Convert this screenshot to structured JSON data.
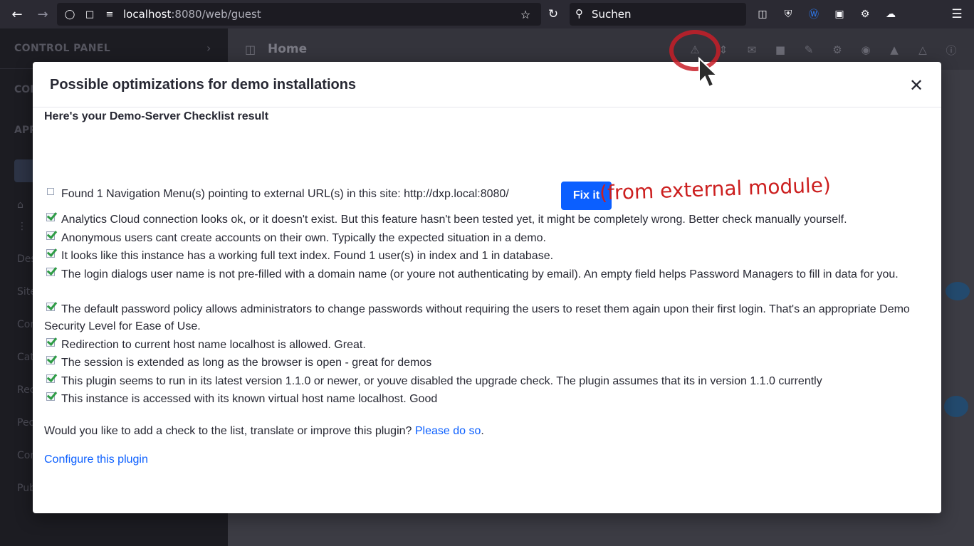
{
  "browser": {
    "url_host": "localhost",
    "url_rest": ":8080/web/guest",
    "search_placeholder": "Suchen"
  },
  "sidebar": {
    "control_panel_label": "CONTROL PANEL",
    "fragments": [
      "CON",
      "APP"
    ],
    "items": [
      "Des",
      "Site",
      "Con",
      "Cat",
      "Rec",
      "Peo",
      "Con",
      "Pub"
    ]
  },
  "header": {
    "title": "Home"
  },
  "modal": {
    "title": "Possible optimizations for demo installations",
    "result_title": "Here's your Demo-Server Checklist result",
    "checks": [
      {
        "status": "unchecked",
        "text": "Found 1 Navigation Menu(s) pointing to external URL(s) in this site: http://dxp.local:8080/"
      },
      {
        "status": "ok",
        "text": "Analytics Cloud connection looks ok, or it doesn't exist. But this feature hasn't been tested yet, it might be completely wrong. Better check manually yourself."
      },
      {
        "status": "ok",
        "text": "Anonymous users cant create accounts on their own. Typically the expected situation in a demo."
      },
      {
        "status": "ok",
        "text": "It looks like this instance has a working full text index. Found 1 user(s) in index and 1 in database."
      },
      {
        "status": "ok",
        "text": "The login dialogs user name is not pre-filled with a domain name (or youre not authenticating by email). An empty field helps Password Managers to fill in data for you."
      },
      {
        "status": "ok",
        "text": "The default password policy allows administrators to change passwords without requiring the users to reset them again upon their first login. That's an appropriate Demo Security Level for Ease of Use."
      },
      {
        "status": "ok",
        "text": "Redirection to current host name localhost is allowed. Great."
      },
      {
        "status": "ok",
        "text": "The session is extended as long as the browser is open - great for demos"
      },
      {
        "status": "ok",
        "text": "This plugin seems to run in its latest version 1.1.0 or newer, or youve disabled the upgrade check. The plugin assumes that its in version 1.1.0 currently"
      },
      {
        "status": "ok",
        "text": "This instance is accessed with its known virtual host name localhost. Good"
      }
    ],
    "fix_button": "Fix it",
    "annotation": "(from external module)",
    "footer_prefix": "Would you like to add a check to the list, translate or improve this plugin? ",
    "footer_link": "Please do so",
    "footer_suffix": ".",
    "configure_link": "Configure this plugin"
  },
  "colors": {
    "primary": "#0b5fff",
    "ok_check": "#2e9c45",
    "annotation_red": "#cc1f1f"
  }
}
